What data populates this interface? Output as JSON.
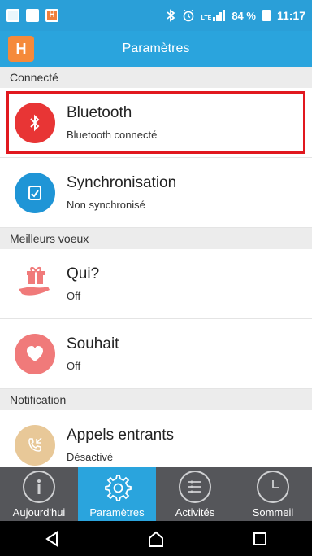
{
  "status_bar": {
    "battery": "84 %",
    "time": "11:17",
    "lte": "LTE"
  },
  "app_bar": {
    "logo": "H",
    "title": "Paramètres"
  },
  "sections": [
    {
      "header": "Connecté",
      "items": [
        {
          "title": "Bluetooth",
          "subtitle": "Bluetooth connecté",
          "icon": "bluetooth-icon",
          "color": "#e83535"
        },
        {
          "title": "Synchronisation",
          "subtitle": "Non synchronisé",
          "icon": "sync-icon",
          "color": "#1f95d6"
        }
      ]
    },
    {
      "header": "Meilleurs voeux",
      "items": [
        {
          "title": "Qui?",
          "subtitle": "Off",
          "icon": "gift-hand-icon",
          "color": "#f07a7a"
        },
        {
          "title": "Souhait",
          "subtitle": "Off",
          "icon": "heart-icon",
          "color": "#f07a7a"
        }
      ]
    },
    {
      "header": "Notification",
      "items": [
        {
          "title": "Appels entrants",
          "subtitle": "Désactivé",
          "icon": "phone-incoming-icon",
          "color": "#e8c898"
        }
      ]
    }
  ],
  "bottom_nav": [
    {
      "label": "Aujourd'hui",
      "icon": "info-icon"
    },
    {
      "label": "Paramètres",
      "icon": "gear-icon",
      "active": true
    },
    {
      "label": "Activités",
      "icon": "list-icon"
    },
    {
      "label": "Sommeil",
      "icon": "clock-icon"
    }
  ]
}
